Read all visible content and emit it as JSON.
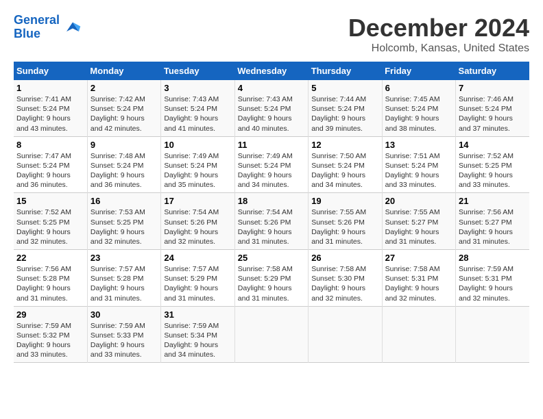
{
  "header": {
    "logo_line1": "General",
    "logo_line2": "Blue",
    "title": "December 2024",
    "subtitle": "Holcomb, Kansas, United States"
  },
  "calendar": {
    "days_of_week": [
      "Sunday",
      "Monday",
      "Tuesday",
      "Wednesday",
      "Thursday",
      "Friday",
      "Saturday"
    ],
    "weeks": [
      [
        {
          "day": "1",
          "sunrise": "Sunrise: 7:41 AM",
          "sunset": "Sunset: 5:24 PM",
          "daylight": "Daylight: 9 hours and 43 minutes."
        },
        {
          "day": "2",
          "sunrise": "Sunrise: 7:42 AM",
          "sunset": "Sunset: 5:24 PM",
          "daylight": "Daylight: 9 hours and 42 minutes."
        },
        {
          "day": "3",
          "sunrise": "Sunrise: 7:43 AM",
          "sunset": "Sunset: 5:24 PM",
          "daylight": "Daylight: 9 hours and 41 minutes."
        },
        {
          "day": "4",
          "sunrise": "Sunrise: 7:43 AM",
          "sunset": "Sunset: 5:24 PM",
          "daylight": "Daylight: 9 hours and 40 minutes."
        },
        {
          "day": "5",
          "sunrise": "Sunrise: 7:44 AM",
          "sunset": "Sunset: 5:24 PM",
          "daylight": "Daylight: 9 hours and 39 minutes."
        },
        {
          "day": "6",
          "sunrise": "Sunrise: 7:45 AM",
          "sunset": "Sunset: 5:24 PM",
          "daylight": "Daylight: 9 hours and 38 minutes."
        },
        {
          "day": "7",
          "sunrise": "Sunrise: 7:46 AM",
          "sunset": "Sunset: 5:24 PM",
          "daylight": "Daylight: 9 hours and 37 minutes."
        }
      ],
      [
        {
          "day": "8",
          "sunrise": "Sunrise: 7:47 AM",
          "sunset": "Sunset: 5:24 PM",
          "daylight": "Daylight: 9 hours and 36 minutes."
        },
        {
          "day": "9",
          "sunrise": "Sunrise: 7:48 AM",
          "sunset": "Sunset: 5:24 PM",
          "daylight": "Daylight: 9 hours and 36 minutes."
        },
        {
          "day": "10",
          "sunrise": "Sunrise: 7:49 AM",
          "sunset": "Sunset: 5:24 PM",
          "daylight": "Daylight: 9 hours and 35 minutes."
        },
        {
          "day": "11",
          "sunrise": "Sunrise: 7:49 AM",
          "sunset": "Sunset: 5:24 PM",
          "daylight": "Daylight: 9 hours and 34 minutes."
        },
        {
          "day": "12",
          "sunrise": "Sunrise: 7:50 AM",
          "sunset": "Sunset: 5:24 PM",
          "daylight": "Daylight: 9 hours and 34 minutes."
        },
        {
          "day": "13",
          "sunrise": "Sunrise: 7:51 AM",
          "sunset": "Sunset: 5:24 PM",
          "daylight": "Daylight: 9 hours and 33 minutes."
        },
        {
          "day": "14",
          "sunrise": "Sunrise: 7:52 AM",
          "sunset": "Sunset: 5:25 PM",
          "daylight": "Daylight: 9 hours and 33 minutes."
        }
      ],
      [
        {
          "day": "15",
          "sunrise": "Sunrise: 7:52 AM",
          "sunset": "Sunset: 5:25 PM",
          "daylight": "Daylight: 9 hours and 32 minutes."
        },
        {
          "day": "16",
          "sunrise": "Sunrise: 7:53 AM",
          "sunset": "Sunset: 5:25 PM",
          "daylight": "Daylight: 9 hours and 32 minutes."
        },
        {
          "day": "17",
          "sunrise": "Sunrise: 7:54 AM",
          "sunset": "Sunset: 5:26 PM",
          "daylight": "Daylight: 9 hours and 32 minutes."
        },
        {
          "day": "18",
          "sunrise": "Sunrise: 7:54 AM",
          "sunset": "Sunset: 5:26 PM",
          "daylight": "Daylight: 9 hours and 31 minutes."
        },
        {
          "day": "19",
          "sunrise": "Sunrise: 7:55 AM",
          "sunset": "Sunset: 5:26 PM",
          "daylight": "Daylight: 9 hours and 31 minutes."
        },
        {
          "day": "20",
          "sunrise": "Sunrise: 7:55 AM",
          "sunset": "Sunset: 5:27 PM",
          "daylight": "Daylight: 9 hours and 31 minutes."
        },
        {
          "day": "21",
          "sunrise": "Sunrise: 7:56 AM",
          "sunset": "Sunset: 5:27 PM",
          "daylight": "Daylight: 9 hours and 31 minutes."
        }
      ],
      [
        {
          "day": "22",
          "sunrise": "Sunrise: 7:56 AM",
          "sunset": "Sunset: 5:28 PM",
          "daylight": "Daylight: 9 hours and 31 minutes."
        },
        {
          "day": "23",
          "sunrise": "Sunrise: 7:57 AM",
          "sunset": "Sunset: 5:28 PM",
          "daylight": "Daylight: 9 hours and 31 minutes."
        },
        {
          "day": "24",
          "sunrise": "Sunrise: 7:57 AM",
          "sunset": "Sunset: 5:29 PM",
          "daylight": "Daylight: 9 hours and 31 minutes."
        },
        {
          "day": "25",
          "sunrise": "Sunrise: 7:58 AM",
          "sunset": "Sunset: 5:29 PM",
          "daylight": "Daylight: 9 hours and 31 minutes."
        },
        {
          "day": "26",
          "sunrise": "Sunrise: 7:58 AM",
          "sunset": "Sunset: 5:30 PM",
          "daylight": "Daylight: 9 hours and 32 minutes."
        },
        {
          "day": "27",
          "sunrise": "Sunrise: 7:58 AM",
          "sunset": "Sunset: 5:31 PM",
          "daylight": "Daylight: 9 hours and 32 minutes."
        },
        {
          "day": "28",
          "sunrise": "Sunrise: 7:59 AM",
          "sunset": "Sunset: 5:31 PM",
          "daylight": "Daylight: 9 hours and 32 minutes."
        }
      ],
      [
        {
          "day": "29",
          "sunrise": "Sunrise: 7:59 AM",
          "sunset": "Sunset: 5:32 PM",
          "daylight": "Daylight: 9 hours and 33 minutes."
        },
        {
          "day": "30",
          "sunrise": "Sunrise: 7:59 AM",
          "sunset": "Sunset: 5:33 PM",
          "daylight": "Daylight: 9 hours and 33 minutes."
        },
        {
          "day": "31",
          "sunrise": "Sunrise: 7:59 AM",
          "sunset": "Sunset: 5:34 PM",
          "daylight": "Daylight: 9 hours and 34 minutes."
        },
        {
          "day": "",
          "sunrise": "",
          "sunset": "",
          "daylight": ""
        },
        {
          "day": "",
          "sunrise": "",
          "sunset": "",
          "daylight": ""
        },
        {
          "day": "",
          "sunrise": "",
          "sunset": "",
          "daylight": ""
        },
        {
          "day": "",
          "sunrise": "",
          "sunset": "",
          "daylight": ""
        }
      ]
    ]
  }
}
